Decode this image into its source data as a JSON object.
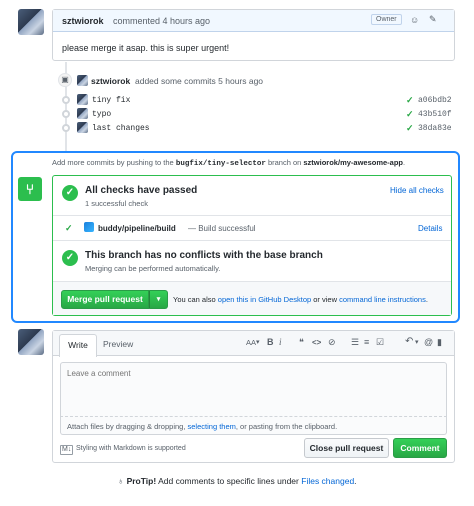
{
  "comment1": {
    "author": "sztwiorok",
    "action": "commented 4 hours ago",
    "badge": "Owner",
    "body": "please merge it asap. this is super urgent!"
  },
  "commits_event": {
    "author": "sztwiorok",
    "action": "added some commits 5 hours ago",
    "commits": [
      {
        "message": "tiny fix",
        "sha": "a06bdb2"
      },
      {
        "message": "typo",
        "sha": "43b510f"
      },
      {
        "message": "last changes",
        "sha": "38da83e"
      }
    ]
  },
  "merge_box": {
    "hint_prefix": "Add more commits by pushing to the",
    "branch": "bugfix/tiny-selector",
    "hint_middle": "branch on",
    "repo": "sztwiorok/my-awesome-app",
    "hint_suffix": ".",
    "checks_title": "All checks have passed",
    "checks_sub": "1 successful check",
    "hide_checks": "Hide all checks",
    "check_name": "buddy/pipeline/build",
    "check_status": "— Build successful",
    "details": "Details",
    "conflict_title": "This branch has no conflicts with the base branch",
    "conflict_sub": "Merging can be performed automatically.",
    "merge_button": "Merge pull request",
    "also_prefix": "You can also",
    "also_link1": "open this in GitHub Desktop",
    "also_middle": "or view",
    "also_link2": "command line instructions",
    "also_suffix": "."
  },
  "editor": {
    "tab_write": "Write",
    "tab_preview": "Preview",
    "placeholder": "Leave a comment",
    "attach_prefix": "Attach files by dragging & dropping,",
    "attach_link": "selecting them",
    "attach_suffix": ", or pasting from the clipboard.",
    "markdown_note": "Styling with Markdown is supported",
    "close_button": "Close pull request",
    "comment_button": "Comment",
    "toolbar": {
      "heading": "AA",
      "bold": "B",
      "italic": "i",
      "quote": "❝",
      "code": "<>",
      "link": "⊘",
      "ul": "☰",
      "ol": "≡",
      "task": "☑",
      "reply": "↶",
      "mention": "@",
      "bookmark": "▮"
    }
  },
  "protip": {
    "label": "ProTip!",
    "text": "Add comments to specific lines under",
    "link": "Files changed",
    "suffix": "."
  },
  "colors": {
    "accent": "#0366d6",
    "success": "#2cbe4e",
    "merge_border": "#2188ff"
  }
}
